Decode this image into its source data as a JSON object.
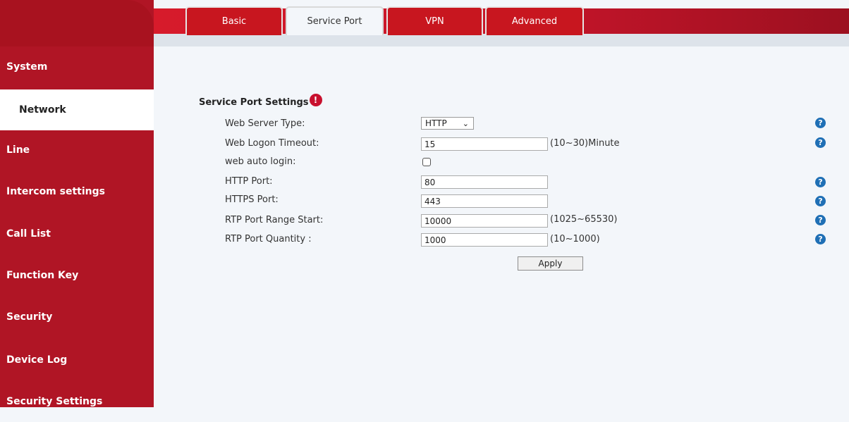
{
  "sidebar": {
    "items": [
      {
        "label": "System"
      },
      {
        "label": "Network"
      },
      {
        "label": "Line"
      },
      {
        "label": "Intercom settings"
      },
      {
        "label": "Call List"
      },
      {
        "label": "Function Key"
      },
      {
        "label": "Security"
      },
      {
        "label": "Device Log"
      },
      {
        "label": "Security Settings"
      }
    ]
  },
  "tabs": [
    {
      "label": "Basic"
    },
    {
      "label": "Service Port"
    },
    {
      "label": "VPN"
    },
    {
      "label": "Advanced"
    }
  ],
  "section": {
    "title": "Service Port Settings",
    "icon": "warning-icon",
    "icon_glyph": "!"
  },
  "fields": {
    "web_server_type": {
      "label": "Web Server Type:",
      "value": "HTTP"
    },
    "web_logon_timeout": {
      "label": "Web Logon Timeout:",
      "value": "15",
      "hint": "(10~30)Minute"
    },
    "web_auto_login": {
      "label": "web auto login:",
      "checked": false
    },
    "http_port": {
      "label": "HTTP Port:",
      "value": "80"
    },
    "https_port": {
      "label": "HTTPS Port:",
      "value": "443"
    },
    "rtp_port_range_start": {
      "label": "RTP Port Range Start:",
      "value": "10000",
      "hint": "(1025~65530)"
    },
    "rtp_port_quantity": {
      "label": "RTP Port Quantity :",
      "value": "1000",
      "hint": "(10~1000)"
    }
  },
  "help_glyph": "?",
  "chevron_glyph": "⌄",
  "apply_label": "Apply",
  "colors": {
    "brand_red": "#b01525",
    "help_blue": "#1f6fb5",
    "background": "#f3f6fa"
  }
}
